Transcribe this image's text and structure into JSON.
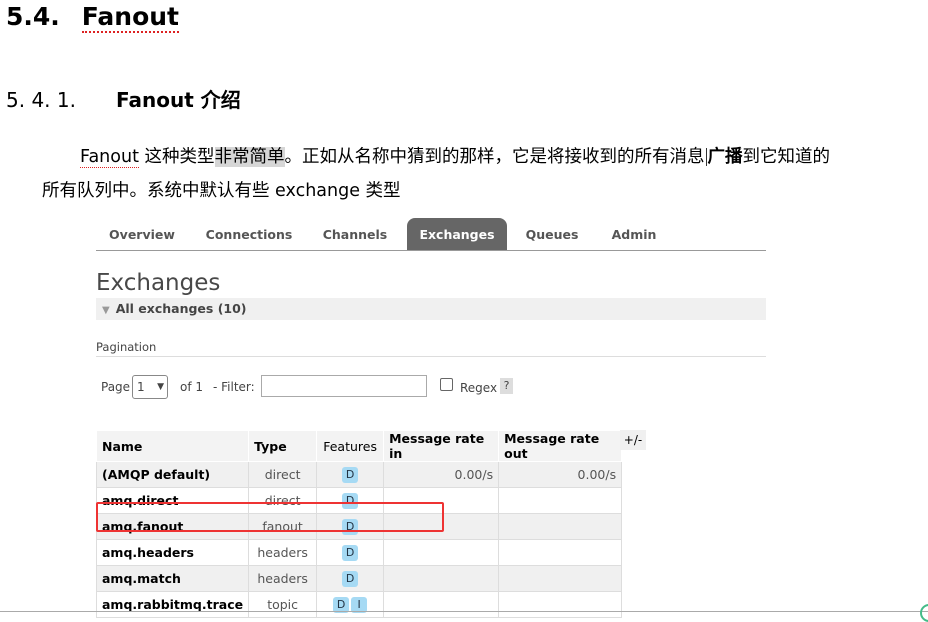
{
  "heading1": {
    "num": "5.4.",
    "title": "Fanout"
  },
  "heading2": {
    "num": "5. 4. 1.",
    "title": "Fanout 介绍"
  },
  "paragraph": {
    "p1": "Fanout",
    "p2": " 这种类型",
    "p3": "非常简单",
    "p4": "。正如从名称中猜到的那样，它是将接收到的所有消息",
    "p5": "广播",
    "p6": "到它知道的",
    "line2": "所有队列中。系统中默认有些 exchange 类型"
  },
  "rabbitmq": {
    "tabs": [
      {
        "label": "Overview"
      },
      {
        "label": "Connections"
      },
      {
        "label": "Channels"
      },
      {
        "label": "Exchanges"
      },
      {
        "label": "Queues"
      },
      {
        "label": "Admin"
      }
    ],
    "active_tab": "Exchanges",
    "page_title": "Exchanges",
    "all_exchanges": "All exchanges (10)",
    "pagination_label": "Pagination",
    "page_label": "Page",
    "page_value": "1",
    "of_label": "of 1",
    "filter_label": "- Filter:",
    "filter_value": "",
    "regex_label": "Regex",
    "help": "?",
    "plus_minus": "+/-",
    "columns": [
      "Name",
      "Type",
      "Features",
      "Message rate in",
      "Message rate out"
    ],
    "rows": [
      {
        "name": "(AMQP default)",
        "type": "direct",
        "features": [
          "D"
        ],
        "rate_in": "0.00/s",
        "rate_out": "0.00/s"
      },
      {
        "name": "amq.direct",
        "type": "direct",
        "features": [
          "D"
        ],
        "rate_in": "",
        "rate_out": ""
      },
      {
        "name": "amq.fanout",
        "type": "fanout",
        "features": [
          "D"
        ],
        "rate_in": "",
        "rate_out": ""
      },
      {
        "name": "amq.headers",
        "type": "headers",
        "features": [
          "D"
        ],
        "rate_in": "",
        "rate_out": ""
      },
      {
        "name": "amq.match",
        "type": "headers",
        "features": [
          "D"
        ],
        "rate_in": "",
        "rate_out": ""
      },
      {
        "name": "amq.rabbitmq.trace",
        "type": "topic",
        "features": [
          "D",
          "I"
        ],
        "rate_in": "",
        "rate_out": ""
      }
    ],
    "highlighted_row": "amq.fanout",
    "colors": {
      "active_tab_bg": "#666666",
      "badge": "#a6daf4",
      "highlight_box": "#e33333"
    }
  }
}
